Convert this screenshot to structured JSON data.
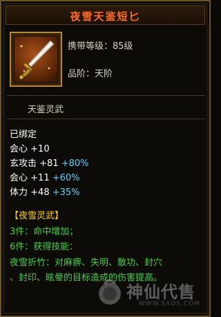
{
  "item": {
    "name": "夜雪天鉴短匕",
    "carry_level": "携带等级：85级",
    "grade": "品阶：天阶",
    "category": "天鉴灵武",
    "bound_status": "已绑定"
  },
  "stats": [
    {
      "name": "会心",
      "value": "+10",
      "bonus": ""
    },
    {
      "name": "玄攻击",
      "value": "+81",
      "bonus": "+80%"
    },
    {
      "name": "会心",
      "value": "+11",
      "bonus": "+60%"
    },
    {
      "name": "体力",
      "value": "+48",
      "bonus": "+35%"
    }
  ],
  "set": {
    "title": "【夜雪灵武】",
    "lines": [
      "3件：命中增加；",
      "6件：获得技能：",
      "夜雪折竹：对麻痹、失明、散功、封穴",
      "、封印、眩晕的目标造成的伤害提高。"
    ]
  },
  "watermark": {
    "logo_text": "神仙代售",
    "url": "WWW.SXDS.COM"
  },
  "colors": {
    "title": "#ff6a2a",
    "stat_bonus": "#5ed4ff",
    "set_title": "#ffd21a",
    "set_text": "#46d04a",
    "border_gold": "#b58a3a"
  },
  "icons": {
    "item_icon": "dagger-icon",
    "watermark_icon": "shenxian-logo-icon"
  }
}
